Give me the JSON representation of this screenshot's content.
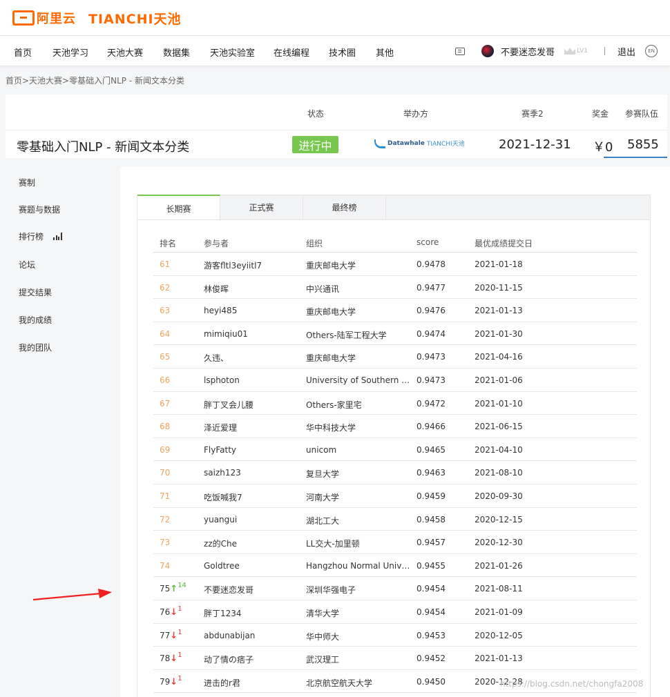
{
  "logo": {
    "ali_text": "阿里云",
    "tianchi_text": "TIANCHI天池"
  },
  "nav": {
    "items": [
      "首页",
      "天池学习",
      "天池大赛",
      "数据集",
      "天池实验室",
      "在线编程",
      "技术圈",
      "其他"
    ],
    "user_name": "不要迷恋发哥",
    "level": "LV1",
    "logout": "退出",
    "lang": "EN"
  },
  "breadcrumb": "首页>天池大赛>零基础入门NLP - 新闻文本分类",
  "competition": {
    "title": "零基础入门NLP - 新闻文本分类",
    "headers": {
      "status": "状态",
      "organizer": "举办方",
      "season": "赛季2",
      "prize": "奖金",
      "teams": "参赛队伍"
    },
    "status": "进行中",
    "organizer_name": "Datawhale",
    "organizer_partner": "TIANCHI天池",
    "date": "2021-12-31",
    "prize": "￥0",
    "teams": "5855",
    "status_color": "#78c850"
  },
  "sidebar": {
    "items": [
      "赛制",
      "赛题与数据",
      "排行榜",
      "论坛",
      "提交结果",
      "我的成绩",
      "我的团队"
    ]
  },
  "tabs": [
    "长期赛",
    "正式赛",
    "最终榜"
  ],
  "table": {
    "headers": [
      "排名",
      "参与者",
      "组织",
      "score",
      "最优成绩提交日"
    ],
    "rows": [
      {
        "rank": "61",
        "name": "游客fltl3eyiitl7",
        "org": "重庆邮电大学",
        "score": "0.9478",
        "date": "2021-01-18"
      },
      {
        "rank": "62",
        "name": "林俊晖",
        "org": "中兴通讯",
        "score": "0.9477",
        "date": "2020-11-15"
      },
      {
        "rank": "63",
        "name": "heyi485",
        "org": "重庆邮电大学",
        "score": "0.9476",
        "date": "2021-01-13"
      },
      {
        "rank": "64",
        "name": "mimiqiu01",
        "org": "Others-陆军工程大学",
        "score": "0.9474",
        "date": "2021-01-30"
      },
      {
        "rank": "65",
        "name": "久违、",
        "org": "重庆邮电大学",
        "score": "0.9473",
        "date": "2021-04-16"
      },
      {
        "rank": "66",
        "name": "lsphoton",
        "org": "University of Southern C...",
        "score": "0.9473",
        "date": "2021-01-06"
      },
      {
        "rank": "67",
        "name": "胖丁叉会儿腰",
        "org": "Others-家里宅",
        "score": "0.9472",
        "date": "2021-01-10"
      },
      {
        "rank": "68",
        "name": "泽近爱理",
        "org": "华中科技大学",
        "score": "0.9466",
        "date": "2021-06-15"
      },
      {
        "rank": "69",
        "name": "FlyFatty",
        "org": "unicom",
        "score": "0.9465",
        "date": "2021-04-10"
      },
      {
        "rank": "70",
        "name": "saizh123",
        "org": "复旦大学",
        "score": "0.9463",
        "date": "2021-08-10"
      },
      {
        "rank": "71",
        "name": "吃饭喊我7",
        "org": "河南大学",
        "score": "0.9459",
        "date": "2020-09-30"
      },
      {
        "rank": "72",
        "name": "yuangui",
        "org": "湖北工大",
        "score": "0.9458",
        "date": "2020-12-15"
      },
      {
        "rank": "73",
        "name": "zz的Che",
        "org": "LL交大-加里顿",
        "score": "0.9457",
        "date": "2020-12-30"
      },
      {
        "rank": "74",
        "name": "Goldtree",
        "org": "Hangzhou Normal Unive...",
        "score": "0.9455",
        "date": "2021-01-26"
      },
      {
        "rank": "75",
        "name": "不要迷恋发哥",
        "org": "深圳华强电子",
        "score": "0.9454",
        "date": "2021-08-11",
        "trend": "up",
        "delta": "14"
      },
      {
        "rank": "76",
        "name": "胖丁1234",
        "org": "清华大学",
        "score": "0.9454",
        "date": "2021-01-09",
        "trend": "down",
        "delta": "1"
      },
      {
        "rank": "77",
        "name": "abdunabijan",
        "org": "华中师大",
        "score": "0.9453",
        "date": "2020-12-05",
        "trend": "down",
        "delta": "1"
      },
      {
        "rank": "78",
        "name": "动了情の痞子",
        "org": "武汉理工",
        "score": "0.9452",
        "date": "2021-01-13",
        "trend": "down",
        "delta": "1"
      },
      {
        "rank": "79",
        "name": "进击的r君",
        "org": "北京航空航天大学",
        "score": "0.9450",
        "date": "2020-12-28",
        "trend": "down",
        "delta": "1"
      }
    ]
  },
  "watermark": "https://blog.csdn.net/chongfa2008",
  "colors": {
    "brand": "#ff6a00",
    "rank_orange": "#f0a45d",
    "up": "#58b83a",
    "down": "#e53c3c",
    "tab_active": "#78c850"
  }
}
